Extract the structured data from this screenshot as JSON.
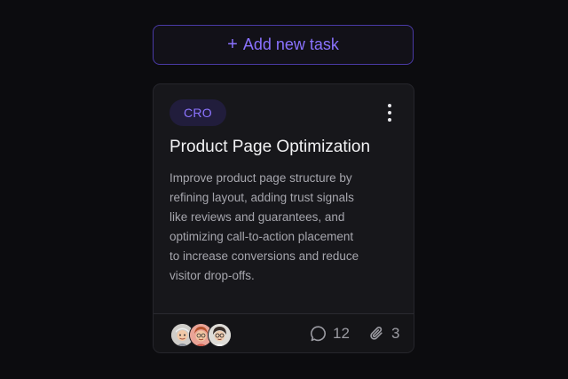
{
  "add_task": {
    "plus_glyph": "+",
    "label": "Add new task"
  },
  "card": {
    "tag": "CRO",
    "more_icon": "vertical-dots-icon",
    "title": "Product Page Optimization",
    "description_lines": [
      "Improve product page structure by",
      "refining layout, adding trust signals",
      "like reviews and guarantees, and",
      "optimizing call-to-action placement",
      "to increase conversions and reduce",
      "visitor drop-offs."
    ],
    "avatars": [
      "avatar-1",
      "avatar-2",
      "avatar-3"
    ],
    "comments": {
      "icon": "comment-icon",
      "count": "12"
    },
    "attachments": {
      "icon": "paperclip-icon",
      "count": "3"
    }
  },
  "colors": {
    "background": "#0c0c0f",
    "card": "#17171b",
    "accent": "#8a72ff",
    "tag_bg": "#211d3c"
  }
}
